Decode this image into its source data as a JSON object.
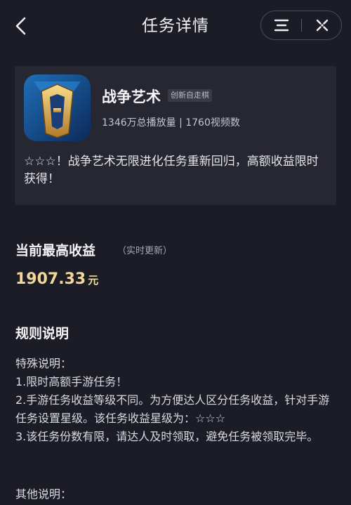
{
  "header": {
    "title": "任务详情",
    "back_icon": "chevron-left-icon",
    "menu_icon": "menu-icon",
    "close_icon": "close-icon"
  },
  "game": {
    "name": "战争艺术",
    "tag": "创新自走棋",
    "stats": "1346万总播放量 | 1760视频数",
    "description": "☆☆☆！战争艺术无限进化任务重新回归，高额收益限时获得！",
    "icon": "game-logo-icon"
  },
  "earnings": {
    "title": "当前最高收益",
    "subtitle": "（实时更新）",
    "amount": "1907.33",
    "unit": "元"
  },
  "rules": {
    "title": "规则说明",
    "lines": [
      "特殊说明：",
      "1.限时高额手游任务！",
      "2.手游任务收益等级不同。为方便达人区分任务收益，针对手游任务设置星级。该任务收益星级为：☆☆☆",
      "3.该任务份数有限，请达人及时领取，避免任务被领取完毕。"
    ],
    "other_title": "其他说明："
  },
  "colors": {
    "background": "#1b1c25",
    "card": "#262731",
    "accent_gold": "#f2d79a"
  }
}
